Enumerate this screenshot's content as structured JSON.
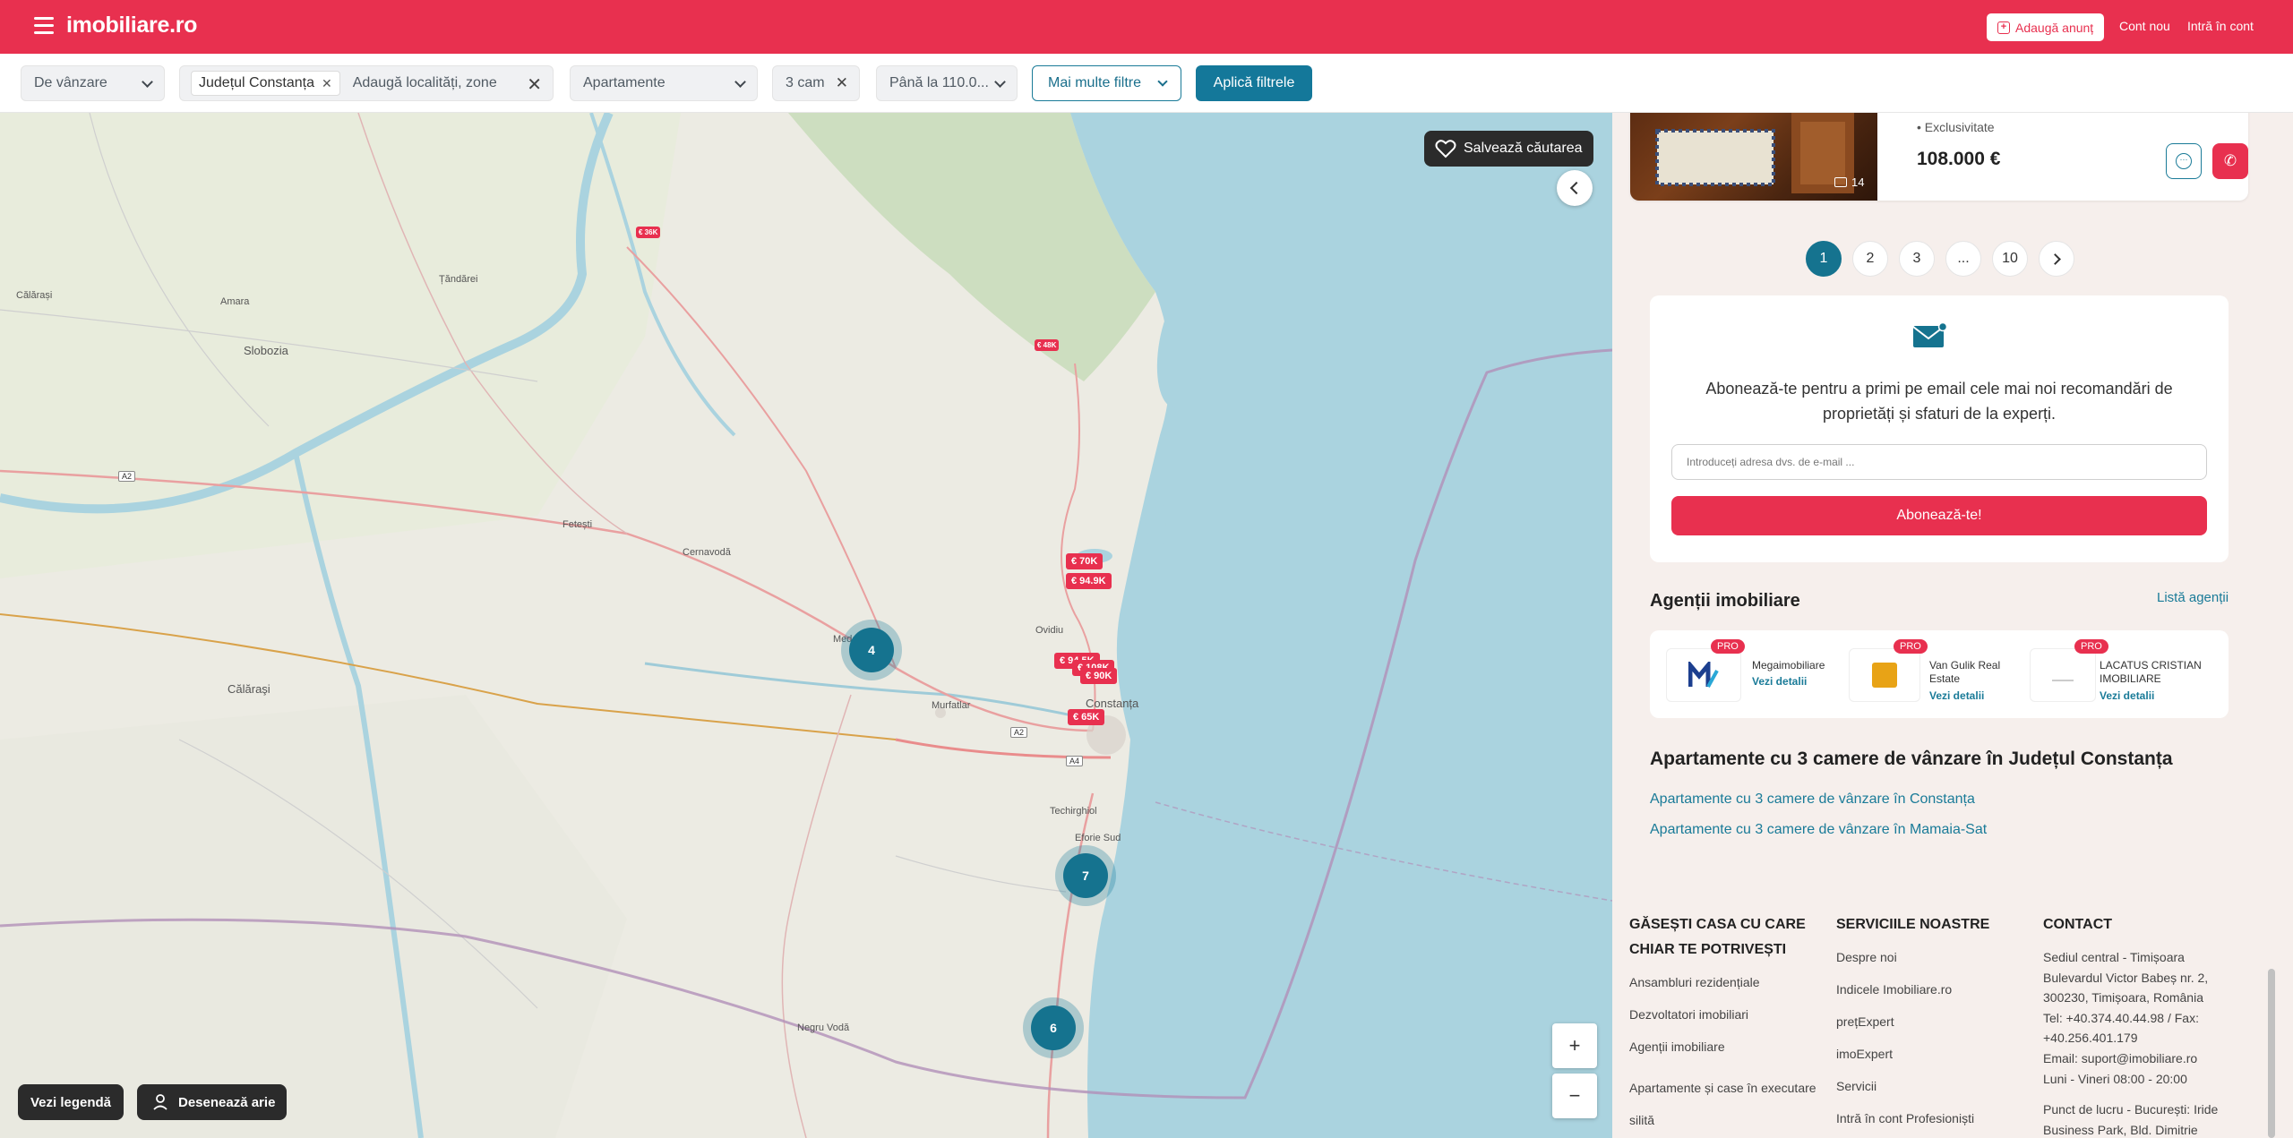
{
  "header": {
    "logo": "imobiliare.ro",
    "add_listing": "Adaugă anunț",
    "new_account": "Cont nou",
    "login": "Intră în cont"
  },
  "filters": {
    "transaction": "De vânzare",
    "location_chip": "Județul Constanța",
    "location_placeholder": "Adaugă localități, zone",
    "property_type": "Apartamente",
    "rooms": "3 cam",
    "price": "Până la 110.0...",
    "more_filters": "Mai multe filtre",
    "apply": "Aplică filtrele"
  },
  "map": {
    "save_search": "Salvează căutarea",
    "legend": "Vezi legendă",
    "draw_area": "Desenează arie",
    "zoom_in": "+",
    "zoom_out": "−",
    "places": [
      "Călărași",
      "Amara",
      "Slobozia",
      "Țăndărei",
      "Fetești",
      "Cernavodă",
      "Medgidia",
      "Murfatlar",
      "Ovidiu",
      "Constanța",
      "Techirghiol",
      "Eforie Sud",
      "Negru Vodă",
      "Călăraşi"
    ],
    "road_labels": [
      "A2",
      "A2",
      "A4"
    ],
    "price_tags": [
      "€ 36K",
      "€ 48K",
      "€ 70K",
      "€ 94.9K",
      "€ 94.5K",
      "€ 108K",
      "€ 90K",
      "€ 65K"
    ],
    "clusters": [
      "4",
      "7",
      "6"
    ]
  },
  "listing": {
    "tag": "• Exclusivitate",
    "price": "108.000 €",
    "photo_count": "14"
  },
  "pagination": [
    "1",
    "2",
    "3",
    "...",
    "10"
  ],
  "newsletter": {
    "text": "Abonează-te pentru a primi pe email cele mai noi recomandări de proprietăți și sfaturi de la experți.",
    "placeholder": "Introduceți adresa dvs. de e-mail ...",
    "button": "Abonează-te!"
  },
  "agencies": {
    "title": "Agenții imobiliare",
    "list_link": "Listă agenții",
    "badge": "PRO",
    "items": [
      {
        "name": "Megaimobiliare",
        "details": "Vezi detalii"
      },
      {
        "name": "Van Gulik Real Estate",
        "details": "Vezi detalii"
      },
      {
        "name": "LACATUS CRISTIAN IMOBILIARE",
        "details": "Vezi detalii"
      }
    ]
  },
  "seo": {
    "title": "Apartamente cu 3 camere de vânzare în Județul Constanța",
    "links": [
      "Apartamente cu 3 camere de vânzare în Constanța",
      "Apartamente cu 3 camere de vânzare în Mamaia-Sat"
    ]
  },
  "footer": {
    "col1": {
      "title": "GĂSEȘTI CASA CU CARE CHIAR TE POTRIVEȘTI",
      "links": [
        "Ansambluri rezidențiale",
        "Dezvoltatori imobiliari",
        "Agenții imobiliare",
        "Apartamente și case în executare silită"
      ]
    },
    "col2": {
      "title": "SERVICIILE NOASTRE",
      "links": [
        "Despre noi",
        "Indicele Imobiliare.ro",
        "prețExpert",
        "imoExpert",
        "Servicii",
        "Intră în cont Profesioniști"
      ]
    },
    "col3": {
      "title": "CONTACT",
      "lines": [
        "Sediul central - Timișoara",
        "Bulevardul Victor Babeș nr. 2,",
        "300230, Timișoara, România",
        "Tel: +40.374.40.44.98 / Fax:",
        "+40.256.401.179",
        "Email: suport@imobiliare.ro",
        "Luni - Vineri 08:00 - 20:00",
        "",
        "Punct de lucru - București: Iride",
        "Business Park, Bld. Dimitrie"
      ]
    }
  },
  "colors": {
    "brand_red": "#e8304f",
    "brand_teal": "#15738f",
    "sea": "#aad3df"
  }
}
